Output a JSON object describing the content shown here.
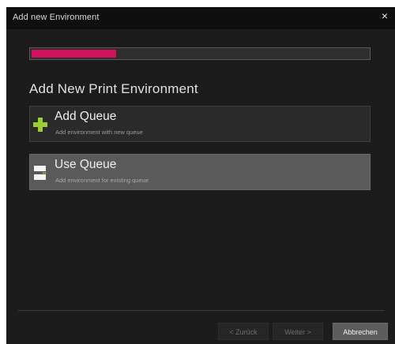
{
  "window": {
    "title": "Add new Environment",
    "close_glyph": "×"
  },
  "progress": {
    "value_percent": 25,
    "fill_color": "#d4115f"
  },
  "main": {
    "heading": "Add New Print Environment",
    "options": [
      {
        "icon": "plus-icon",
        "title": "Add Queue",
        "subtitle": "Add environment with new queue",
        "selected": false,
        "icon_color": "#9acd32"
      },
      {
        "icon": "queue-icon",
        "title": "Use Queue",
        "subtitle": "Add environment for existing queue",
        "selected": true
      }
    ]
  },
  "footer": {
    "back_label": "< Zurück",
    "next_label": "Weiter >",
    "cancel_label": "Abbrechen"
  }
}
